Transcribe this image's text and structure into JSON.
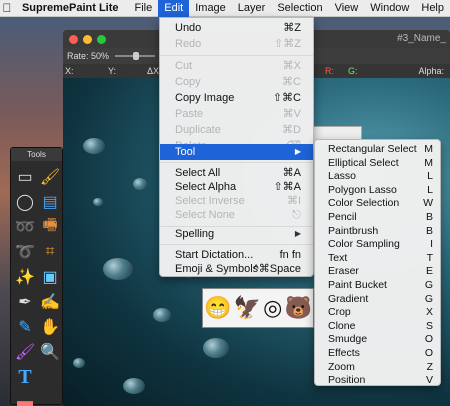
{
  "menubar": {
    "app": "SupremePaint Lite",
    "items": [
      "File",
      "Edit",
      "Image",
      "Layer",
      "Selection",
      "View",
      "Window",
      "Help"
    ]
  },
  "document": {
    "rate": "Rate: 50%",
    "x_label": "X:",
    "y_label": "Y:",
    "dx_label": "ΔX:",
    "alpha_label": "Alpha:",
    "title_fragment": "...",
    "file_fragment": "#3_Name_"
  },
  "tools_palette": {
    "title": "Tools"
  },
  "edit_menu": {
    "items": [
      {
        "label": "Undo",
        "shortcut": "⌘Z",
        "enabled": true
      },
      {
        "label": "Redo",
        "shortcut": "⇧⌘Z",
        "enabled": false
      },
      {
        "label": "Cut",
        "shortcut": "⌘X",
        "enabled": false
      },
      {
        "label": "Copy",
        "shortcut": "⌘C",
        "enabled": false
      },
      {
        "label": "Copy Image",
        "shortcut": "⇧⌘C",
        "enabled": true
      },
      {
        "label": "Paste",
        "shortcut": "⌘V",
        "enabled": false
      },
      {
        "label": "Duplicate",
        "shortcut": "⌘D",
        "enabled": false
      },
      {
        "label": "Delete",
        "shortcut": "⌫",
        "enabled": false
      },
      {
        "label": "Tool",
        "shortcut": "▶",
        "enabled": true,
        "selected": true
      },
      {
        "label": "Select All",
        "shortcut": "⌘A",
        "enabled": true
      },
      {
        "label": "Select Alpha",
        "shortcut": "⇧⌘A",
        "enabled": true
      },
      {
        "label": "Select Inverse",
        "shortcut": "⌘I",
        "enabled": false
      },
      {
        "label": "Select None",
        "shortcut": "⎋",
        "enabled": false
      },
      {
        "label": "Spelling",
        "shortcut": "▶",
        "enabled": true
      },
      {
        "label": "Start Dictation...",
        "shortcut": "fn fn",
        "enabled": true
      },
      {
        "label": "Emoji & Symbols",
        "shortcut": "^⌘Space",
        "enabled": true
      }
    ]
  },
  "tool_submenu": {
    "items": [
      {
        "label": "Rectangular Select",
        "shortcut": "M"
      },
      {
        "label": "Elliptical Select",
        "shortcut": "M"
      },
      {
        "label": "Lasso",
        "shortcut": "L"
      },
      {
        "label": "Polygon Lasso",
        "shortcut": "L"
      },
      {
        "label": "Color Selection",
        "shortcut": "W"
      },
      {
        "label": "Pencil",
        "shortcut": "B"
      },
      {
        "label": "Paintbrush",
        "shortcut": "B"
      },
      {
        "label": "Color Sampling",
        "shortcut": "I"
      },
      {
        "label": "Text",
        "shortcut": "T"
      },
      {
        "label": "Eraser",
        "shortcut": "E"
      },
      {
        "label": "Paint Bucket",
        "shortcut": "G"
      },
      {
        "label": "Gradient",
        "shortcut": "G"
      },
      {
        "label": "Crop",
        "shortcut": "X"
      },
      {
        "label": "Clone",
        "shortcut": "S"
      },
      {
        "label": "Smudge",
        "shortcut": "O"
      },
      {
        "label": "Effects",
        "shortcut": "O"
      },
      {
        "label": "Zoom",
        "shortcut": "Z"
      },
      {
        "label": "Position",
        "shortcut": "V"
      }
    ]
  },
  "colors": {
    "accent": "#1f63d8",
    "menu_bg": "#f0f0f0",
    "disabled": "#b4b4b4"
  }
}
